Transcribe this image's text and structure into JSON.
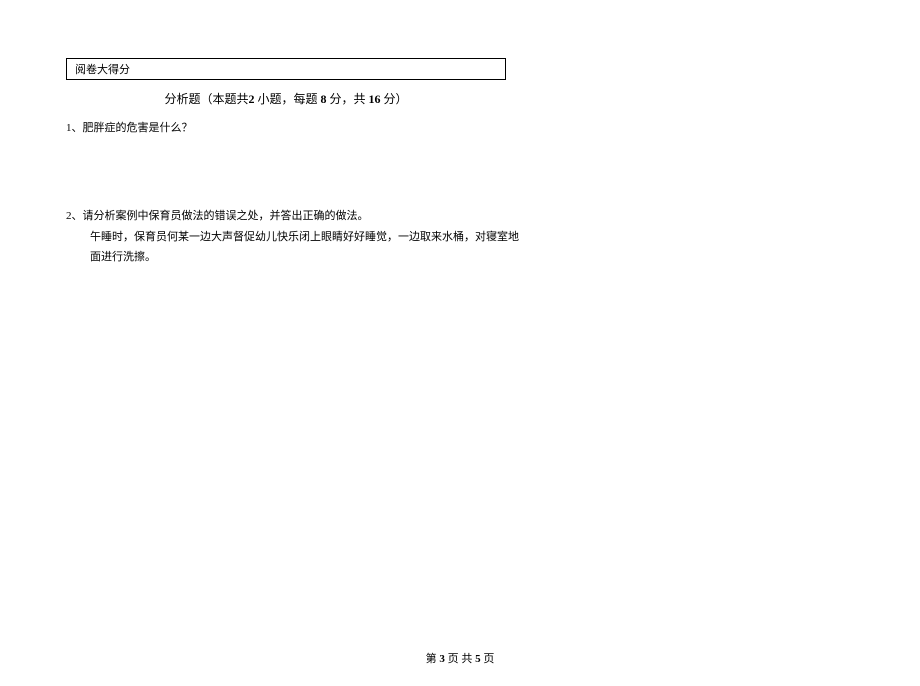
{
  "header": {
    "score_label": "阅卷大得分"
  },
  "section": {
    "title_prefix": "分析题（本题共",
    "count": "2",
    "mid1": " 小题，每题 ",
    "per_score": "8",
    "mid2": " 分，共 ",
    "total_score": "16",
    "suffix": " 分）"
  },
  "questions": {
    "q1": {
      "number": "1、",
      "text": "肥胖症的危害是什么？"
    },
    "q2": {
      "number": "2、",
      "text": "请分析案例中保育员做法的错误之处，并答出正确的做法。",
      "body_line1": "午睡时，保育员何某一边大声督促幼儿快乐闭上眼睛好好睡觉，一边取来水桶，对寝室地",
      "body_line2": "面进行洗擦。"
    }
  },
  "footer": {
    "page_prefix": "第 ",
    "current": "3",
    "page_mid": " 页 共 ",
    "total": "5",
    "page_suffix": " 页"
  }
}
